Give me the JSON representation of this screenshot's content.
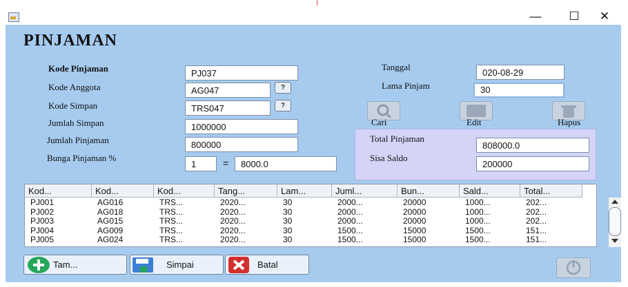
{
  "window": {
    "minimize_glyph": "—",
    "maximize_glyph": "☐",
    "close_glyph": "✕"
  },
  "form": {
    "title": "PINJAMAN",
    "labels": {
      "kode_pinjaman": "Kode Pinjaman",
      "kode_anggota": "Kode Anggota",
      "kode_simpan": "Kode Simpan",
      "jumlah_simpan": "Jumlah Simpan",
      "jumlah_pinjaman": "Jumlah Pinjaman",
      "bunga_pinjaman": "Bunga Pinjaman %",
      "tanggal": "Tanggal",
      "lama_pinjam": "Lama Pinjam",
      "total_pinjaman": "Total  Pinjaman",
      "sisa_saldo": "Sisa Saldo"
    },
    "values": {
      "kode_pinjaman": "PJ037",
      "kode_anggota": "AG047",
      "kode_simpan": "TRS047",
      "jumlah_simpan": "1000000",
      "jumlah_pinjaman": "800000",
      "bunga_percent": "1",
      "equals": "=",
      "bunga_amount": "8000.0",
      "tanggal": "020-08-29",
      "lama_pinjam": "30",
      "total_pinjaman": "808000.0",
      "sisa_saldo": "200000"
    },
    "lookup_label": "?",
    "actions": {
      "cari": "Cari",
      "edit": "Edit",
      "hapus": "Hapus"
    }
  },
  "table": {
    "columns": [
      "Kod...",
      "Kod...",
      "Kod...",
      "Tang...",
      "Lam...",
      "Juml...",
      "Bun...",
      "Sald...",
      "Total..."
    ],
    "rows": [
      [
        "PJ001",
        "AG016",
        "TRS...",
        "2020...",
        "30",
        "2000...",
        "20000",
        "1000...",
        "202..."
      ],
      [
        "PJ002",
        "AG018",
        "TRS...",
        "2020...",
        "30",
        "2000...",
        "20000",
        "1000...",
        "202..."
      ],
      [
        "PJ003",
        "AG015",
        "TRS...",
        "2020...",
        "30",
        "2000...",
        "20000",
        "1000...",
        "202..."
      ],
      [
        "PJ004",
        "AG009",
        "TRS...",
        "2020...",
        "30",
        "1500...",
        "15000",
        "1500...",
        "151..."
      ],
      [
        "PJ005",
        "AG024",
        "TRS...",
        "2020...",
        "30",
        "1500...",
        "15000",
        "1500...",
        "151..."
      ]
    ]
  },
  "footer": {
    "tambah": "Tam...",
    "simpan": "Simpai",
    "batal": "Batal"
  },
  "colors": {
    "panel_bg": "#a6cbef",
    "summary_bg": "#d4d4f8",
    "add_green": "#26a65b",
    "cancel_red": "#d32f2f",
    "save_blue": "#3d7fd6"
  }
}
